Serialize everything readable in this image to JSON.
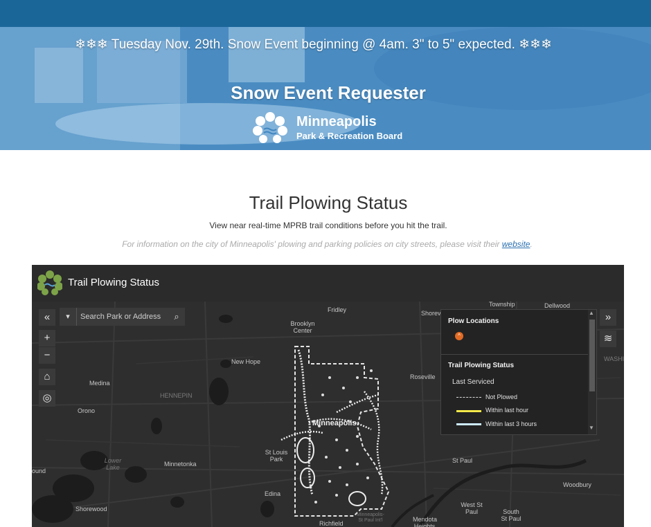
{
  "banner": {
    "announcement": "❄❄❄ Tuesday Nov. 29th.  Snow Event beginning @ 4am.  3\" to 5\" expected. ❄❄❄",
    "title": "Snow Event Requester",
    "logo_name": "Minneapolis",
    "logo_sub": "Park & Recreation Board"
  },
  "section": {
    "title": "Trail Plowing Status",
    "subtitle": "View near real-time MPRB trail conditions before you hit the trail.",
    "info_text": "For information on the city of Minneapolis' plowing and parking policies on city streets, please visit their ",
    "info_link": "website",
    "info_end": "."
  },
  "app": {
    "title": "Trail Plowing Status",
    "search_placeholder": "Search Park or Address",
    "controls": {
      "collapse": "«",
      "expand": "»",
      "zoom_in": "+",
      "zoom_out": "−",
      "home": "⌂",
      "locate": "◎",
      "search": "⌕",
      "dropdown": "▾",
      "layers": "≋"
    },
    "legend": {
      "plow_heading": "Plow Locations",
      "plow_icon": "^",
      "status_heading": "Trail Plowing Status",
      "last_serviced": "Last Serviced",
      "items": [
        {
          "label": "Not Plowed",
          "color": "#dddddd",
          "style": "dashed"
        },
        {
          "label": "Within last hour",
          "color": "#f5e94a",
          "style": "solid"
        },
        {
          "label": "Within last 3 hours",
          "color": "#cdebff",
          "style": "solid"
        }
      ],
      "scroll_up": "▲",
      "scroll_down": "▼"
    },
    "map_labels": [
      "Fridley",
      "Township",
      "Dellwood",
      "Shoreview",
      "Brooklyn Center",
      "New Hope",
      "Roseville",
      "Medina",
      "HENNEPIN",
      "Orono",
      "Minneapolis",
      "St Louis Park",
      "Lower Lake",
      "Minnetonka",
      "St Paul",
      "Edina",
      "Woodbury",
      "Shorewood",
      "West St Paul",
      "South St Paul",
      "Mendota Heights",
      "Richfield",
      "Minneapolis-St Paul Int'l",
      "WASHI",
      "ound"
    ]
  },
  "colors": {
    "topbar": "#1b6699",
    "accent_link": "#2a6fb0",
    "map_bg": "#2e2e2e",
    "plow_marker": "#e26b25"
  }
}
